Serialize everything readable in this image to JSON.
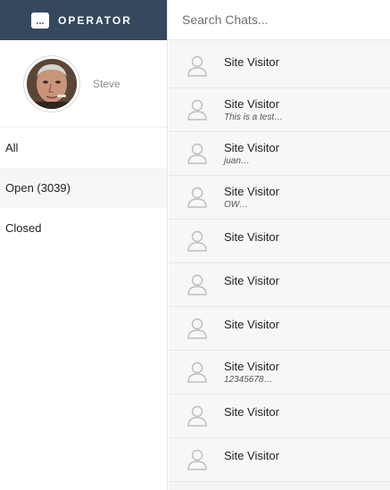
{
  "brand": {
    "logo_glyph": "...",
    "name": "OPERATOR",
    "color": "#34495e"
  },
  "profile": {
    "name": "Steve"
  },
  "nav": [
    {
      "label": "All"
    },
    {
      "label": "Open (3039)"
    },
    {
      "label": "Closed"
    }
  ],
  "search": {
    "placeholder": "Search Chats..."
  },
  "chats": [
    {
      "name": "Site Visitor",
      "preview": ""
    },
    {
      "name": "Site Visitor",
      "preview": "This is a test…"
    },
    {
      "name": "Site Visitor",
      "preview": "juan…"
    },
    {
      "name": "Site Visitor",
      "preview": "OW…"
    },
    {
      "name": "Site Visitor",
      "preview": ""
    },
    {
      "name": "Site Visitor",
      "preview": ""
    },
    {
      "name": "Site Visitor",
      "preview": ""
    },
    {
      "name": "Site Visitor",
      "preview": "12345678…"
    },
    {
      "name": "Site Visitor",
      "preview": ""
    },
    {
      "name": "Site Visitor",
      "preview": ""
    }
  ],
  "icons": {
    "chat_avatar": "user-outline-icon",
    "brand": "chat-bubble-icon"
  }
}
